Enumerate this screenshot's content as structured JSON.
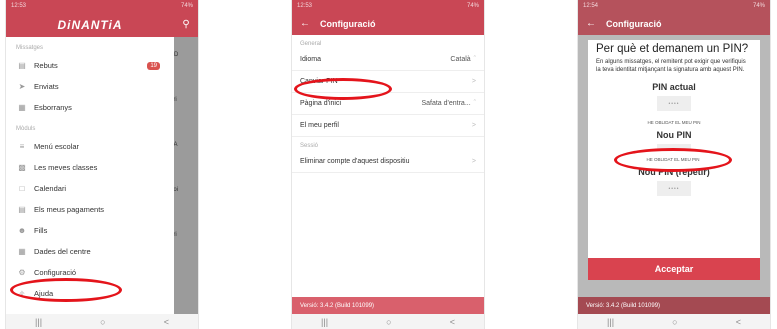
{
  "colors": {
    "brand": "#c94755",
    "highlight": "#e4141b",
    "badge": "#d9534f"
  },
  "phone1": {
    "status_time": "12:53",
    "status_right": "74%",
    "brand": "DiNANTiA",
    "search_icon": "search-icon",
    "sections": {
      "messages": "Missatges",
      "modules": "Mòduls"
    },
    "bg_items": [
      "AD",
      "ari",
      "PA",
      "poi",
      "ari"
    ],
    "items": [
      {
        "label": "Rebuts",
        "icon": "inbox-icon",
        "badge": "19"
      },
      {
        "label": "Enviats",
        "icon": "send-icon"
      },
      {
        "label": "Esborranys",
        "icon": "draft-icon"
      },
      {
        "label": "Menú escolar",
        "icon": "menu-icon"
      },
      {
        "label": "Les meves classes",
        "icon": "classes-icon"
      },
      {
        "label": "Calendari",
        "icon": "calendar-icon"
      },
      {
        "label": "Els meus pagaments",
        "icon": "payment-icon"
      },
      {
        "label": "Fills",
        "icon": "children-icon"
      },
      {
        "label": "Dades del centre",
        "icon": "building-icon"
      },
      {
        "label": "Configuració",
        "icon": "gear-icon"
      },
      {
        "label": "Ajuda",
        "icon": "help-icon"
      }
    ]
  },
  "phone2": {
    "status_time": "12:53",
    "status_right": "74%",
    "title": "Configuració",
    "sections": {
      "general": "General",
      "session": "Sessió"
    },
    "rows": [
      {
        "label": "Idioma",
        "value": "Català"
      },
      {
        "label": "Canviar PIN",
        "value": ""
      },
      {
        "label": "Pàgina d'inici",
        "value": "Safata d'entra..."
      },
      {
        "label": "El meu perfil",
        "value": ""
      },
      {
        "label": "Eliminar compte d'aquest dispositiu",
        "value": ""
      }
    ],
    "version": "Versió: 3.4.2 (Build 101099)"
  },
  "phone3": {
    "status_time": "12:54",
    "status_right": "74%",
    "title": "Configuració",
    "dialog_title": "Per què et demanem un PIN?",
    "dialog_text": "En alguns missatges, el remitent pot exigir que verifiquis la teva identitat mitjançant la signatura amb aquest PIN.",
    "current_pin": "PIN actual",
    "forgot": "HE OBLIDAT EL MEU PIN",
    "new_pin": "Nou PIN",
    "repeat_pin": "Nou PIN (repetir)",
    "pin_mask": "••••",
    "accept": "Acceptar",
    "version": "Versió: 3.4.2 (Build 101099)"
  },
  "navbar": {
    "recents": "|||",
    "home": "○",
    "back": "<"
  }
}
